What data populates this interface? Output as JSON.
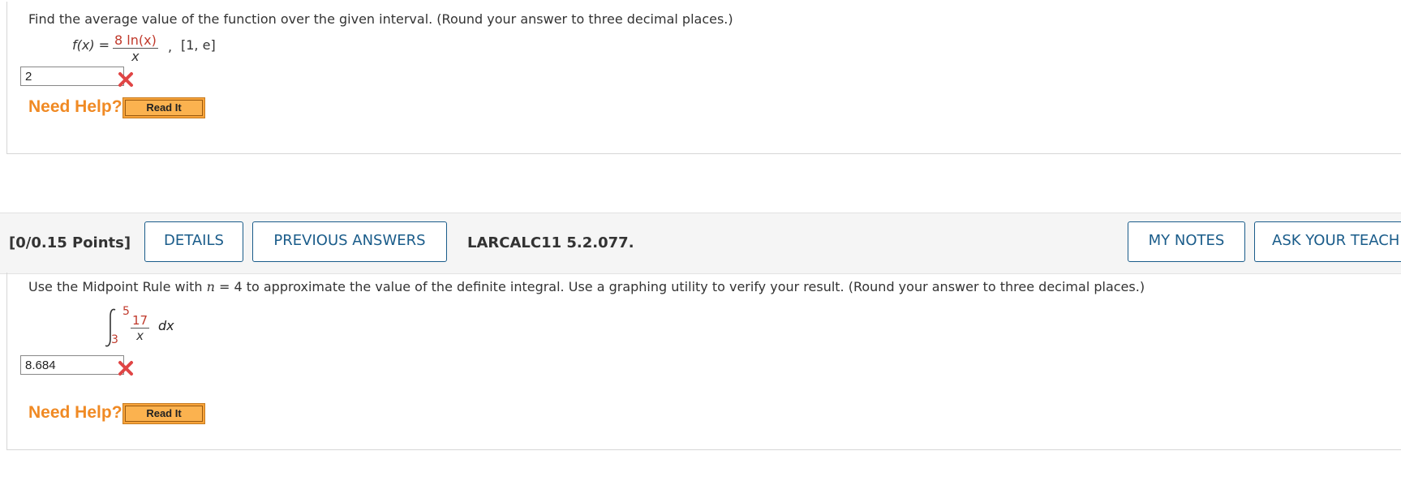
{
  "question1": {
    "prompt": "Find the average value of the function over the given interval. (Round your answer to three decimal places.)",
    "function_lhs": "f(x) =",
    "numerator": "8 ln(x)",
    "denominator": "x",
    "comma": ",",
    "interval": "[1, e]",
    "answer_value": "2",
    "status": "incorrect",
    "need_help": "Need Help?",
    "read_it": "Read It"
  },
  "question2_header": {
    "points": "[0/0.15 Points]",
    "details": "DETAILS",
    "previous_answers": "PREVIOUS ANSWERS",
    "problem_code": "LARCALC11 5.2.077.",
    "my_notes": "MY NOTES",
    "ask_teacher": "ASK YOUR TEACH"
  },
  "question2": {
    "prompt_part1": "Use the Midpoint Rule with ",
    "n_var": "n",
    "prompt_part2": " = 4  to approximate the value of the definite integral. Use a graphing utility to verify your result. (Round your answer to three decimal places.)",
    "upper_limit": "5",
    "lower_limit": "3",
    "integrand_numerator": "17",
    "integrand_denominator": "x",
    "differential": "dx",
    "answer_value": "8.684",
    "status": "incorrect",
    "need_help": "Need Help?",
    "read_it": "Read It"
  },
  "colors": {
    "accent_blue": "#1a5c8a",
    "help_orange": "#f08a24",
    "incorrect_red": "#e04545",
    "button_orange": "#f7a33a"
  }
}
